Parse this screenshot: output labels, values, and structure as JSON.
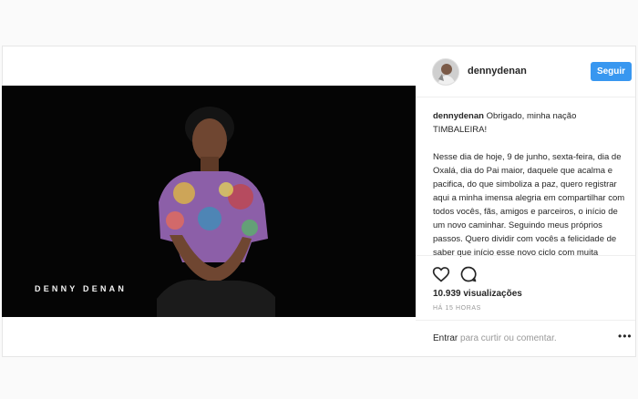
{
  "post": {
    "username": "dennydenan",
    "follow_label": "Seguir",
    "video_overlay_text": "DENNY DENAN",
    "caption_user": "dennydenan",
    "caption_first": "Obrigado, minha nação TIMBALEIRA!",
    "caption_body": "Nesse dia de hoje, 9 de junho, sexta-feira, dia de Oxalá, dia do Pai maior, daquele que acalma e pacifica, do que simboliza a paz, quero registrar aqui a minha imensa alegria em compartilhar com todos vocês, fãs, amigos e parceiros, o início de um novo caminhar. Seguindo meus próprios passos. Quero dividir com vocês a felicidade de saber que início esse novo ciclo com muita",
    "views": "10.939 visualizações",
    "time_ago": "HÁ 15 HORAS",
    "login_link": "Entrar",
    "login_text": "para curtir ou comentar.",
    "more_label": "•••"
  },
  "icons": {
    "like": "heart-icon",
    "comment": "comment-icon",
    "options": "more-icon"
  },
  "colors": {
    "accent": "#3897f0",
    "video_bg": "#050505"
  }
}
